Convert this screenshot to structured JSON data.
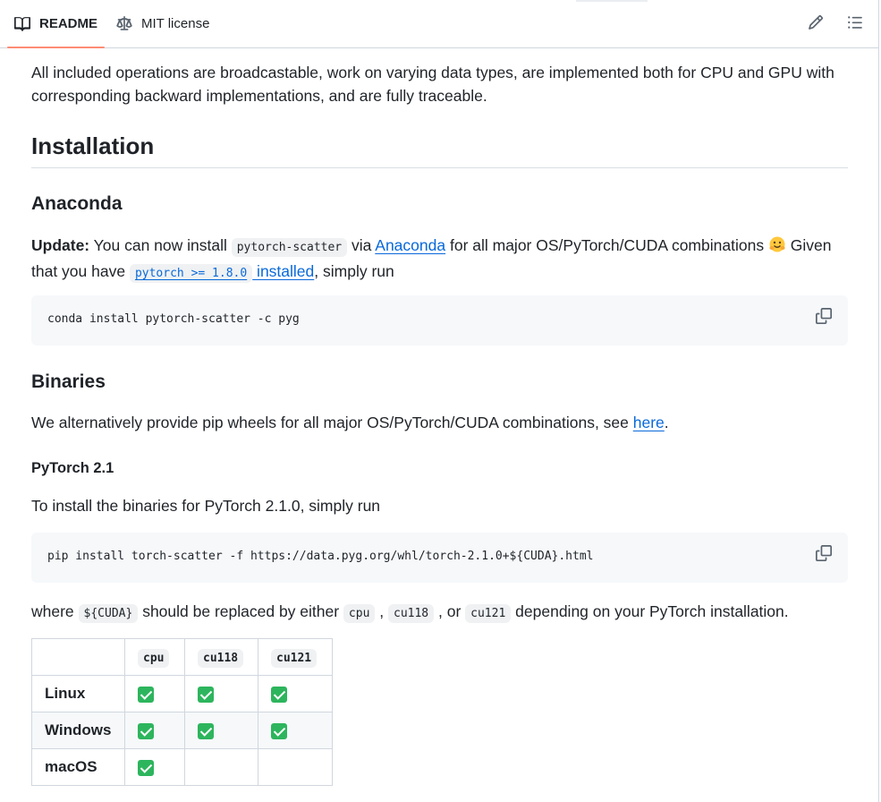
{
  "tabs": {
    "readme": "README",
    "license": "MIT license"
  },
  "toolbar": {
    "edit_icon": "pencil-icon",
    "outline_icon": "list-unordered-icon"
  },
  "intro": "All included operations are broadcastable, work on varying data types, are implemented both for CPU and GPU with corresponding backward implementations, and are fully traceable.",
  "installation": {
    "title": "Installation",
    "anaconda": {
      "title": "Anaconda",
      "update_label": "Update:",
      "text_1": " You can now install ",
      "pkg_code": "pytorch-scatter",
      "text_2": " via ",
      "anaconda_link": "Anaconda",
      "text_3": " for all major OS/PyTorch/CUDA combinations ",
      "emoji": "hugging-face-emoji",
      "text_4": " Given that you have ",
      "req_code": "pytorch >= 1.8.0",
      "installed_link": " installed",
      "text_5": ", simply run",
      "command": "conda install pytorch-scatter -c pyg"
    },
    "binaries": {
      "title": "Binaries",
      "text_1": "We alternatively provide pip wheels for all major OS/PyTorch/CUDA combinations, see ",
      "here_link": "here",
      "text_2": ".",
      "pytorch_title": "PyTorch 2.1",
      "install_text": "To install the binaries for PyTorch 2.1.0, simply run",
      "command": "pip install torch-scatter -f https://data.pyg.org/whl/torch-2.1.0+${CUDA}.html",
      "where_1": "where ",
      "cuda_code": "${CUDA}",
      "where_2": " should be replaced by either ",
      "cpu_code": "cpu",
      "comma_1": " , ",
      "cu118_code": "cu118",
      "where_3": " , or ",
      "cu121_code": "cu121",
      "where_4": " depending on your PyTorch installation."
    }
  },
  "table": {
    "headers": [
      "",
      "cpu",
      "cu118",
      "cu121"
    ],
    "rows": [
      {
        "label": "Linux",
        "cpu": true,
        "cu118": true,
        "cu121": true
      },
      {
        "label": "Windows",
        "cpu": true,
        "cu118": true,
        "cu121": true
      },
      {
        "label": "macOS",
        "cpu": true,
        "cu118": false,
        "cu121": false
      }
    ],
    "check_icon": "white-check-mark-icon"
  },
  "colors": {
    "link": "#0969da",
    "tab_underline": "#fd8c73",
    "check": "#2db55d",
    "code_bg": "#f6f8fa"
  }
}
